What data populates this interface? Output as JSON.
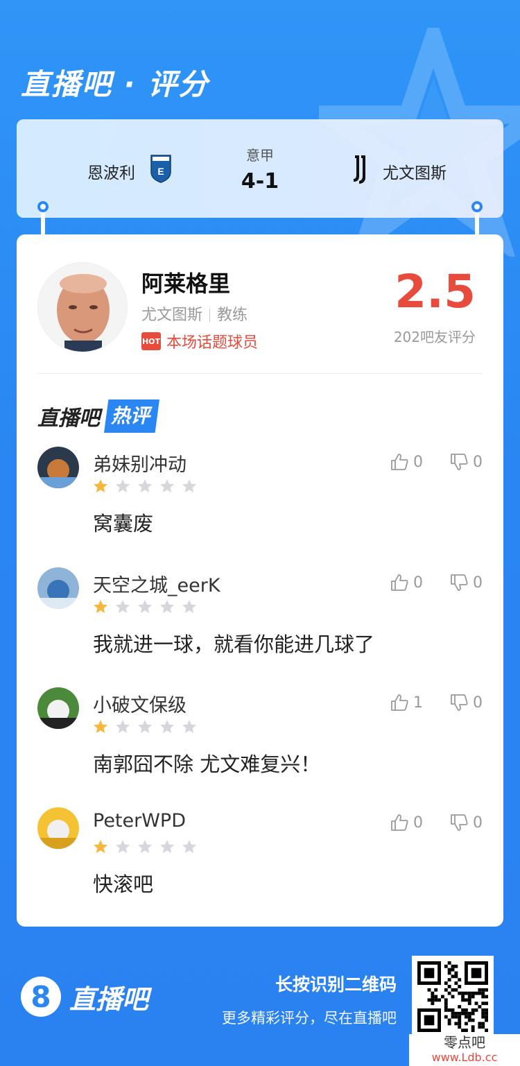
{
  "header": {
    "title": "直播吧 · 评分"
  },
  "match": {
    "home_team": "恩波利",
    "away_team": "尤文图斯",
    "league": "意甲",
    "score": "4-1",
    "home_logo_text": "EMPOLI F.C."
  },
  "coach": {
    "name": "阿莱格里",
    "team": "尤文图斯",
    "role": "教练",
    "hot_badge": "HOT",
    "hot_label": "本场话题球员",
    "rating": "2.5",
    "rating_label": "202吧友评分"
  },
  "hot_section": {
    "title_prefix": "直播吧",
    "title_tag": "热评"
  },
  "comments": [
    {
      "user": "弟妹别冲动",
      "stars": 1,
      "likes": "0",
      "dislikes": "0",
      "text": "窝囊废"
    },
    {
      "user": "天空之城_eerK",
      "stars": 1,
      "likes": "0",
      "dislikes": "0",
      "text": "我就进一球，就看你能进几球了"
    },
    {
      "user": "小破文保级",
      "stars": 1,
      "likes": "1",
      "dislikes": "0",
      "text": "南郭囧不除 尤文难复兴！"
    },
    {
      "user": "PeterWPD",
      "stars": 1,
      "likes": "0",
      "dislikes": "0",
      "text": "快滚吧"
    }
  ],
  "footer": {
    "logo_digit": "8",
    "logo_text": "直播吧",
    "cta_main": "长按识别二维码",
    "cta_sub": "更多精彩评分，尽在直播吧"
  },
  "watermark": {
    "line1": "零点吧",
    "line2": "www.Ldb.cc"
  },
  "colors": {
    "brand_blue": "#2a86f2",
    "accent_red": "#e84a3c",
    "star_gold": "#f6b73c",
    "star_gray": "#d5d7dc"
  }
}
